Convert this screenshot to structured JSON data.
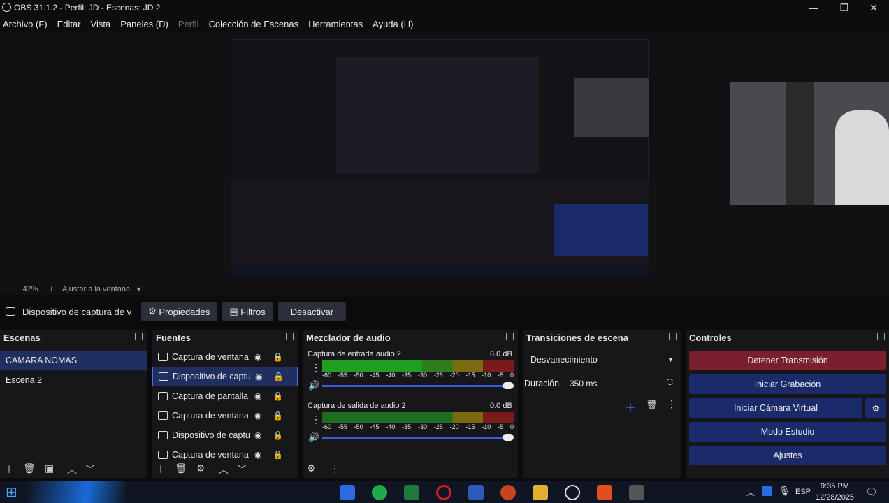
{
  "window": {
    "title": "OBS 31.1.2 - Perfil: JD - Escenas: JD 2",
    "min": "—",
    "max": "❐",
    "close": "✕"
  },
  "menu": [
    "Archivo (F)",
    "Editar",
    "Vista",
    "Paneles (D)",
    "Perfil",
    "Colección de Escenas",
    "Herramientas",
    "Ayuda (H)"
  ],
  "zoom": {
    "minus": "−",
    "value": "47%",
    "plus": "+",
    "fit": "Ajustar a la ventana"
  },
  "source_bar": {
    "name": "Dispositivo de captura de v",
    "props": "Propiedades",
    "filters": "Filtros",
    "deactivate": "Desactivar"
  },
  "scenes": {
    "title": "Escenas",
    "items": [
      "CAMARA NOMAS",
      "Escena 2"
    ]
  },
  "sources": {
    "title": "Fuentes",
    "items": [
      "Captura de ventana",
      "Dispositivo de captu",
      "Captura de pantalla",
      "Captura de ventana",
      "Dispositivo de captu",
      "Captura de ventana"
    ]
  },
  "mixer": {
    "title": "Mezclador de audio",
    "channels": [
      {
        "name": "Captura de entrada audio 2",
        "db": "6.0 dB"
      },
      {
        "name": "Captura de salida de audio 2",
        "db": "0.0 dB"
      }
    ],
    "ticks": [
      "-60",
      "-55",
      "-50",
      "-45",
      "-40",
      "-35",
      "-30",
      "-25",
      "-20",
      "-15",
      "-10",
      "-5",
      "0"
    ]
  },
  "transitions": {
    "title": "Transiciones de escena",
    "selected": "Desvanecimiento",
    "duration_label": "Duración",
    "duration_value": "350 ms"
  },
  "controls": {
    "title": "Controles",
    "stop_stream": "Detener Transmisión",
    "start_rec": "Iniciar Grabación",
    "start_vcam": "Iniciar Cámara Virtual",
    "studio": "Modo Estudio",
    "settings": "Ajustes"
  },
  "taskbar": {
    "lang": "ESP",
    "time": "9:35 PM",
    "date": "12/28/2025"
  },
  "colors": {
    "stop": "#7a1f2e",
    "blue": "#1b2a6b",
    "selected": "#1f2f5f"
  }
}
